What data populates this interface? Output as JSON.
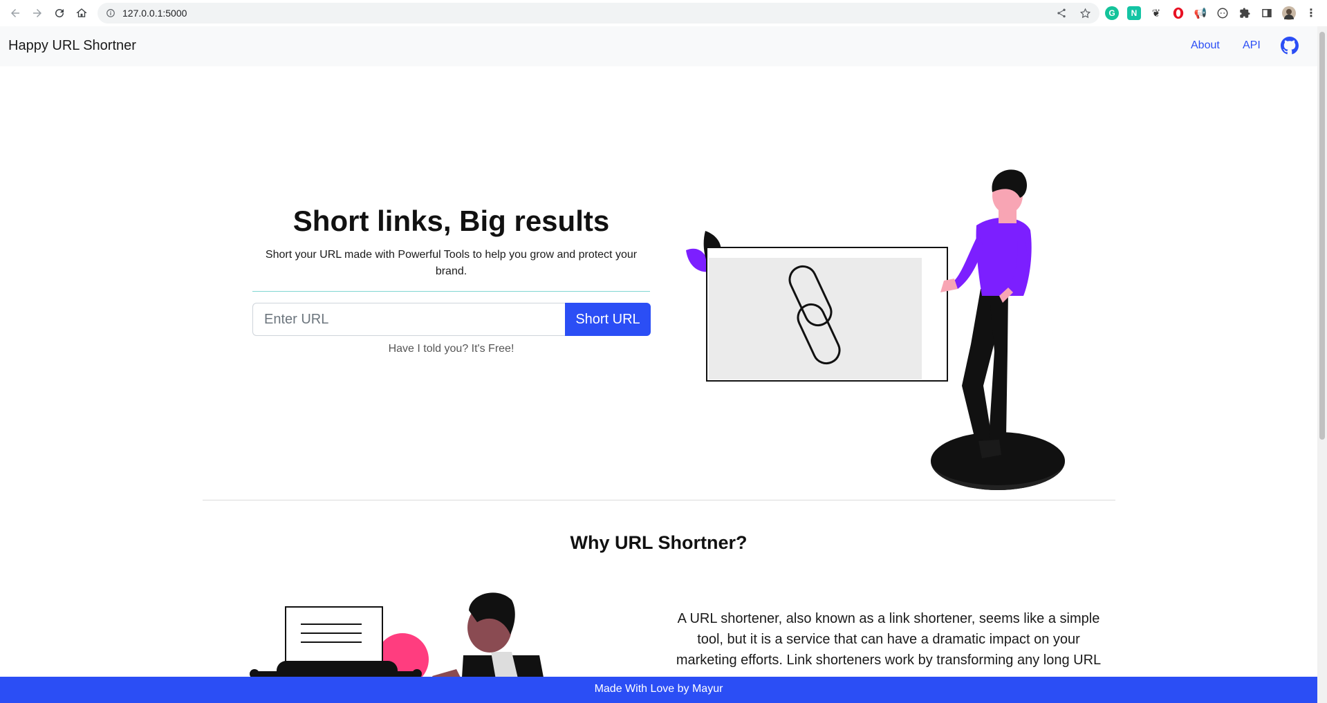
{
  "browser": {
    "url": "127.0.0.1:5000",
    "extensions": [
      {
        "icon": "grammarly-icon",
        "letter": "G",
        "color": "#15c39a"
      },
      {
        "icon": "notion-ext-icon",
        "letter": "N",
        "color": "#14c4a4"
      },
      {
        "icon": "leaf-ext-icon",
        "letter": "",
        "color": "#333333"
      },
      {
        "icon": "opera-ext-icon",
        "letter": "",
        "color": "#e81123"
      },
      {
        "icon": "megaphone-ext-icon",
        "letter": "",
        "color": "#e53935"
      },
      {
        "icon": "dots-ext-icon",
        "letter": "",
        "color": "#444444"
      },
      {
        "icon": "puzzle-icon",
        "letter": "",
        "color": "#444444"
      },
      {
        "icon": "sidepanel-icon",
        "letter": "",
        "color": "#444444"
      },
      {
        "icon": "profile-avatar",
        "letter": "",
        "color": "#9e8f80"
      }
    ]
  },
  "navbar": {
    "brand": "Happy URL Shortner",
    "links": [
      "About",
      "API"
    ]
  },
  "hero": {
    "title": "Short links, Big results",
    "subtitle": "Short your URL made with Powerful Tools to help you grow and protect your brand.",
    "input_placeholder": "Enter URL",
    "button_label": "Short URL",
    "note": "Have I told you? It's Free!"
  },
  "why": {
    "title": "Why URL Shortner?",
    "body": "A URL shortener, also known as a link shortener, seems like a simple tool, but it is a service that can have a dramatic impact on your marketing efforts. Link shorteners work by transforming any long URL"
  },
  "footer": {
    "text": "Made With Love by Mayur"
  },
  "colors": {
    "accent": "#2b4ef5",
    "purple": "#7c1fff",
    "navbar_bg": "#f8f9fa"
  }
}
